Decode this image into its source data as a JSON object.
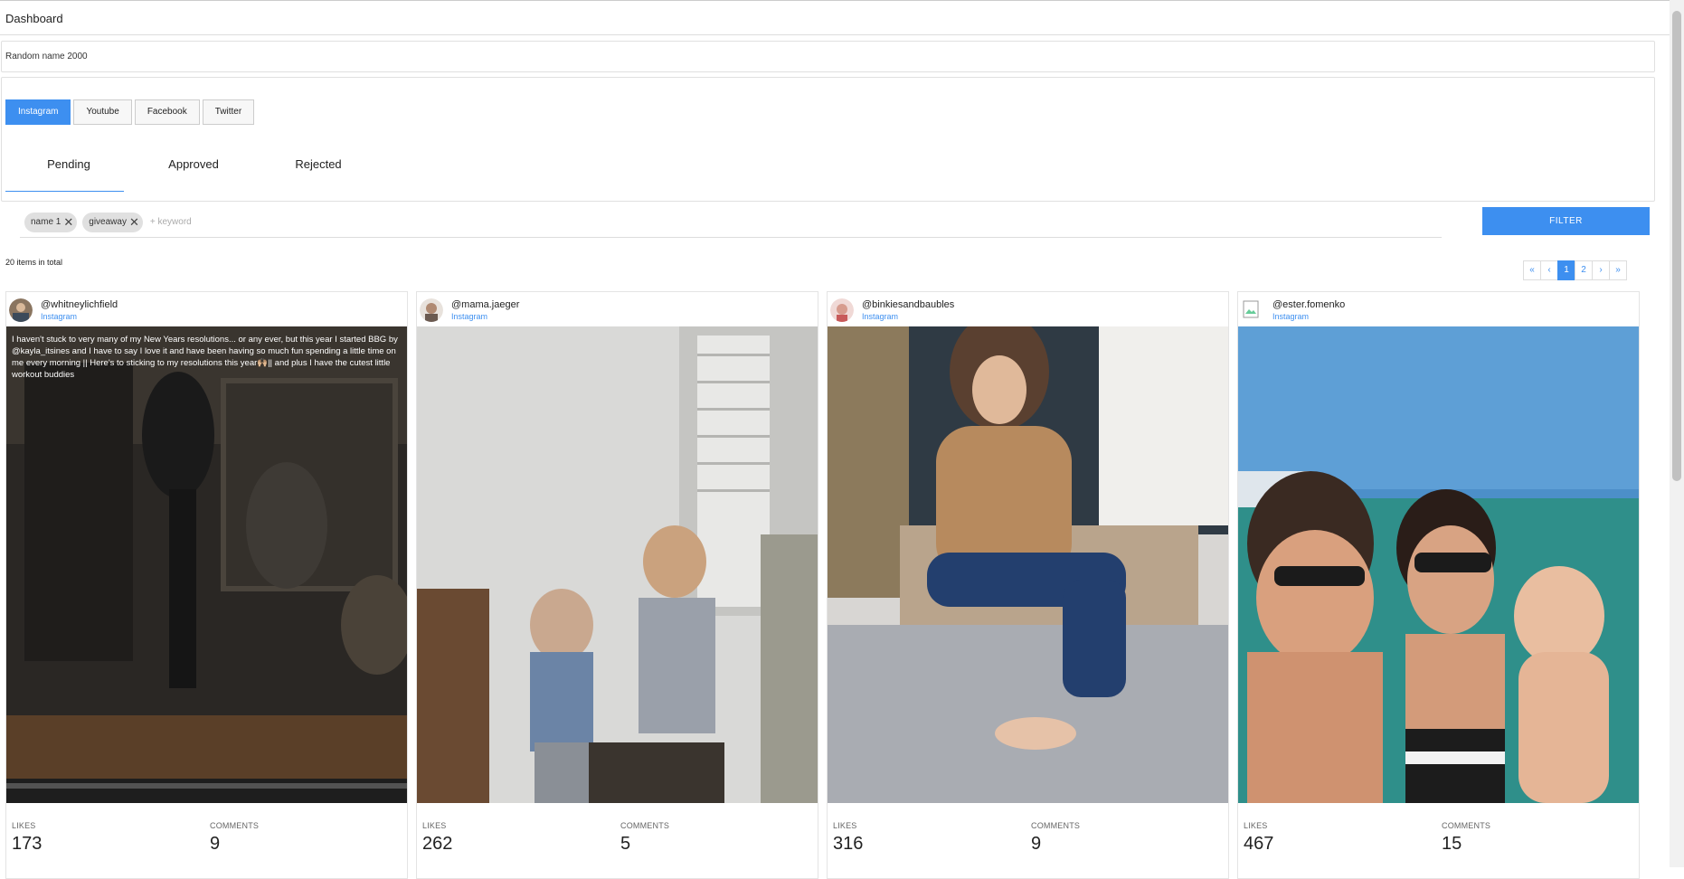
{
  "header": {
    "title": "Dashboard"
  },
  "campaign": {
    "name": "Random name 2000"
  },
  "platform_tabs": [
    "Instagram",
    "Youtube",
    "Facebook",
    "Twitter"
  ],
  "status_tabs": [
    "Pending",
    "Approved",
    "Rejected"
  ],
  "filter": {
    "chips": [
      "name 1",
      "giveaway"
    ],
    "keyword_placeholder": "+ keyword",
    "button_label": "FILTER"
  },
  "total_label": "20 items in total",
  "pagination": [
    "«",
    "‹",
    "1",
    "2",
    "›",
    "»"
  ],
  "cards": [
    {
      "handle": "@whitneylichfield",
      "platform": "Instagram",
      "caption": "I haven't stuck to very many of my New Years resolutions... or any ever, but this year I started BBG by @kayla_itsines and I have to say I love it and have been having so much fun spending a little time on me every morning || Here's to sticking to my resolutions this year🙌🏼|| and plus I have the cutest little workout buddies",
      "likes_label": "LIKES",
      "likes": "173",
      "comments_label": "COMMENTS",
      "comments": "9"
    },
    {
      "handle": "@mama.jaeger",
      "platform": "Instagram",
      "likes_label": "LIKES",
      "likes": "262",
      "comments_label": "COMMENTS",
      "comments": "5"
    },
    {
      "handle": "@binkiesandbaubles",
      "platform": "Instagram",
      "likes_label": "LIKES",
      "likes": "316",
      "comments_label": "COMMENTS",
      "comments": "9"
    },
    {
      "handle": "@ester.fomenko",
      "platform": "Instagram",
      "likes_label": "LIKES",
      "likes": "467",
      "comments_label": "COMMENTS",
      "comments": "15"
    }
  ],
  "colors": {
    "accent": "#3d8ff0"
  }
}
